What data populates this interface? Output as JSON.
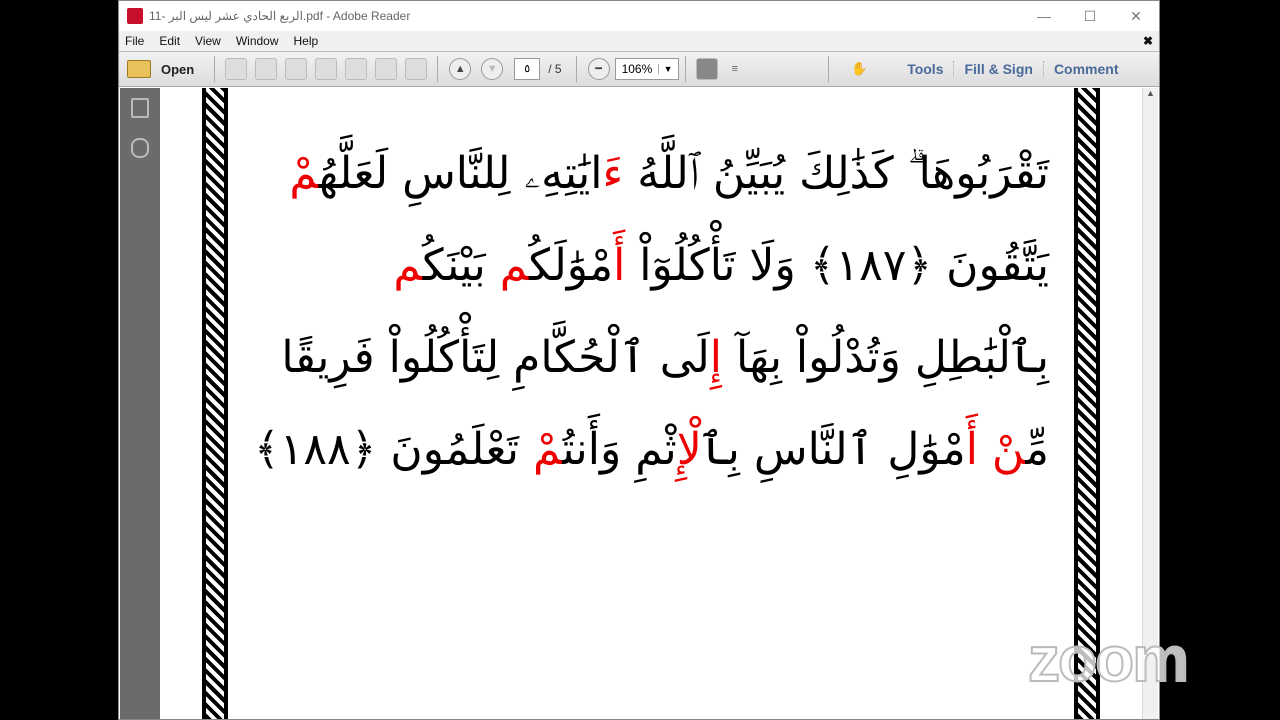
{
  "window": {
    "title": "الربع الحادي عشر ليس البر -11.pdf - Adobe Reader"
  },
  "menu": [
    "File",
    "Edit",
    "View",
    "Window",
    "Help"
  ],
  "toolbar": {
    "open": "Open",
    "page_current": "٥",
    "page_total": "/ 5",
    "zoom": "106%",
    "tools": "Tools",
    "fill_sign": "Fill & Sign",
    "comment": "Comment"
  },
  "document": {
    "lines": [
      [
        {
          "t": "تَقْرَبُوهَا ۗ كَذَٰلِكَ يُبَيِّنُ ٱللَّهُ "
        },
        {
          "t": "ءَ",
          "r": true
        },
        {
          "t": "ايَٰتِهِۦ لِلنَّاسِ لَعَلَّهُ"
        },
        {
          "t": "مْ",
          "r": true
        }
      ],
      [
        {
          "t": "يَتَّقُونَ ﴿١٨٧﴾ وَلَا تَأْكُلُوٓاْ "
        },
        {
          "t": "أَ",
          "r": true
        },
        {
          "t": "مْوَٰلَكُ"
        },
        {
          "t": "م",
          "r": true
        },
        {
          "t": " بَيْنَكُ"
        },
        {
          "t": "م",
          "r": true
        }
      ],
      [
        {
          "t": "بِٱلْبَٰطِلِ وَتُدْلُواْ بِهَآ "
        },
        {
          "t": "إِ",
          "r": true
        },
        {
          "t": "لَى ٱلْحُكَّامِ لِتَأْكُلُواْ فَرِيقًا"
        }
      ],
      [
        {
          "t": "مِّ"
        },
        {
          "t": "نْ أَ",
          "r": true
        },
        {
          "t": "مْوَٰلِ ٱلنَّاسِ بِٱ"
        },
        {
          "t": "لْإِ",
          "r": true
        },
        {
          "t": "ثْمِ وَأَنتُ"
        },
        {
          "t": "مْ",
          "r": true
        },
        {
          "t": " تَعْلَمُونَ ﴿١٨٨﴾"
        }
      ]
    ]
  },
  "watermark": "zoom"
}
